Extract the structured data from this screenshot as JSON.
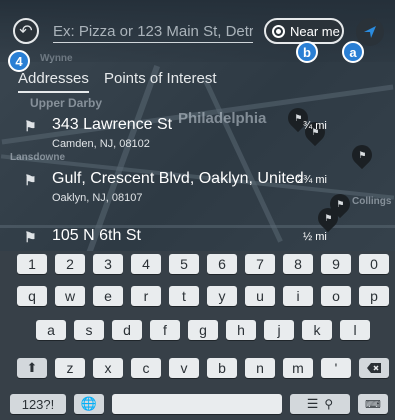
{
  "search": {
    "placeholder": "Ex: Pizza or 123 Main St, Detro",
    "near_me_label": "Near me"
  },
  "badges": {
    "left": "4",
    "near_me": "b",
    "nav": "a"
  },
  "map_labels": [
    "Wynne",
    "Upper Darby",
    "Philadelphia",
    "Lansdowne",
    "Collings"
  ],
  "tabs": [
    {
      "label": "Addresses"
    },
    {
      "label": "Points of Interest"
    }
  ],
  "results": [
    {
      "title": "343 Lawrence St",
      "subtitle": "Camden, NJ, 08102",
      "distance": "¾ mi"
    },
    {
      "title": "Gulf, Crescent Blvd, Oaklyn, United",
      "subtitle": "Oaklyn, NJ, 08107",
      "distance": "2¾ mi"
    },
    {
      "title": "105 N 6th St",
      "subtitle": "",
      "distance": "½ mi"
    }
  ],
  "keyboard": {
    "row1": [
      "1",
      "2",
      "3",
      "4",
      "5",
      "6",
      "7",
      "8",
      "9",
      "0"
    ],
    "row2": [
      "q",
      "w",
      "e",
      "r",
      "t",
      "y",
      "u",
      "i",
      "o",
      "p"
    ],
    "row3": [
      "a",
      "s",
      "d",
      "f",
      "g",
      "h",
      "j",
      "k",
      "l"
    ],
    "row4": [
      "z",
      "x",
      "c",
      "v",
      "b",
      "n",
      "m",
      "'"
    ],
    "symbols_label": "123?!",
    "icons": [
      "shift-icon",
      "backspace-icon",
      "globe-icon",
      "menu-icon",
      "keyboard-hide-icon"
    ]
  },
  "colors": {
    "accent": "#2a7fd4",
    "background": "#2e3a44",
    "key": "#e9ecee"
  }
}
